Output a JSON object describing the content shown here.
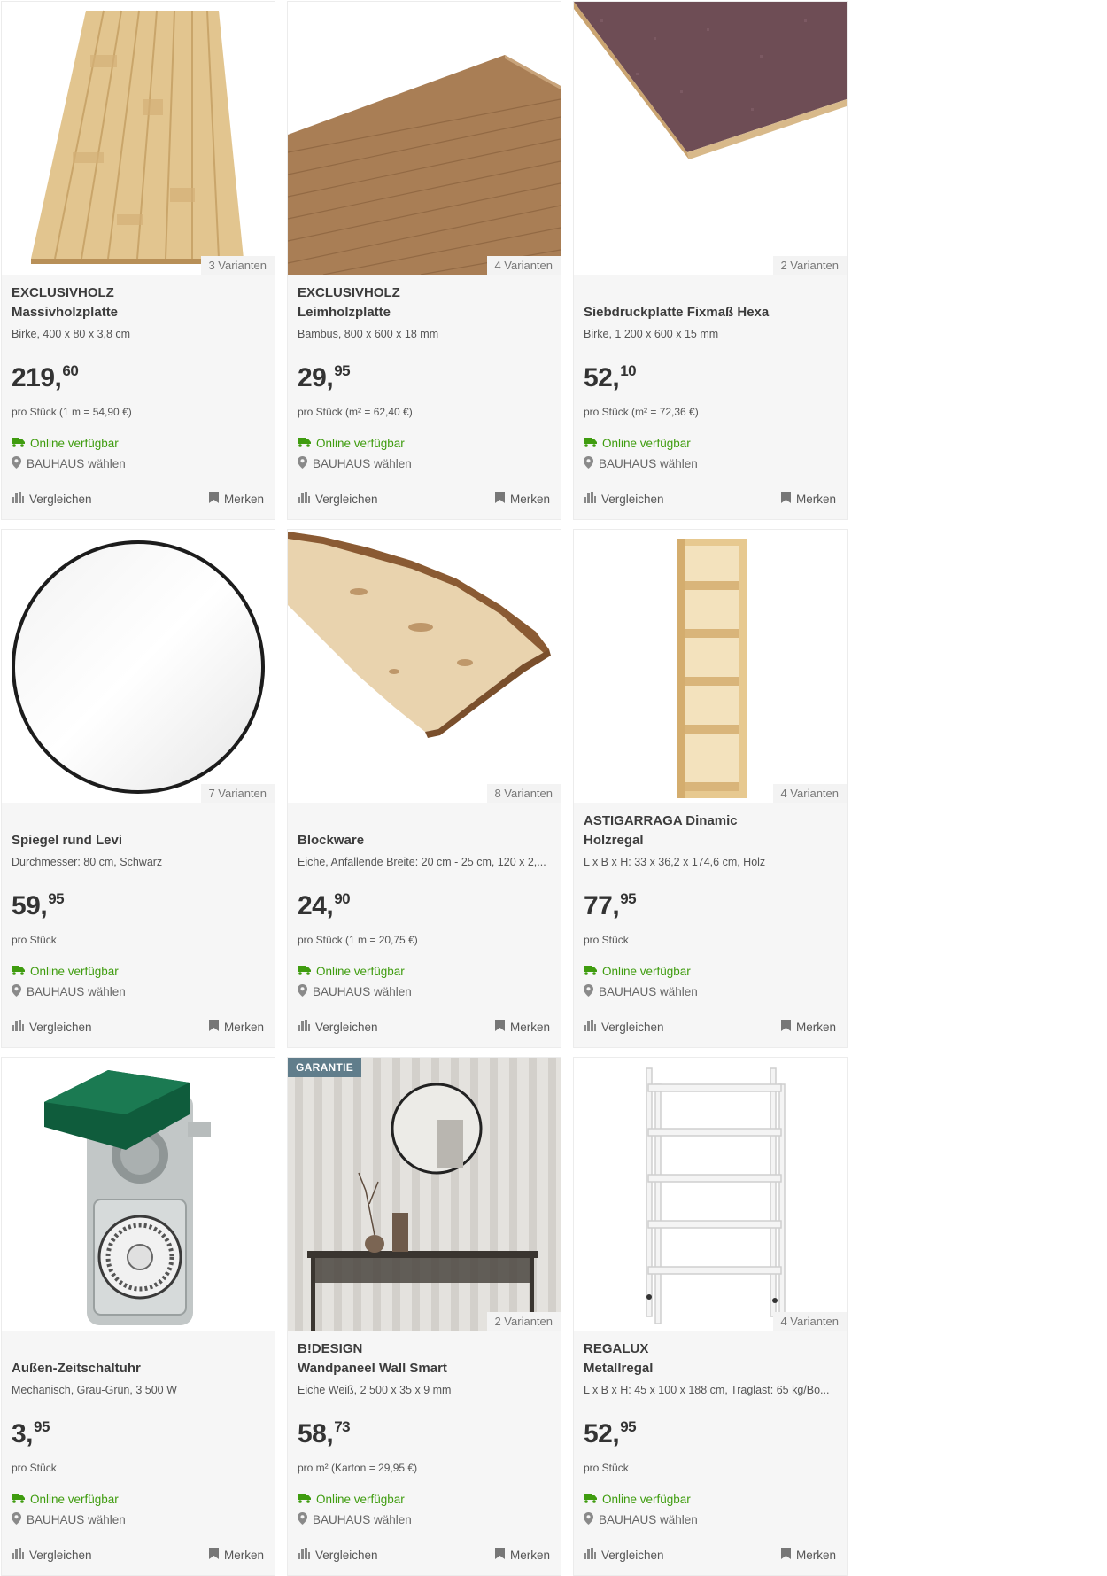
{
  "ui": {
    "online_label": "Online verfügbar",
    "store_label": "BAUHAUS wählen",
    "compare_label": "Vergleichen",
    "remember_label": "Merken"
  },
  "colors": {
    "online_green": "#3f9c0f",
    "badge": "#607d8b",
    "card_bg": "#f6f6f6"
  },
  "products": [
    {
      "brand": "EXCLUSIVHOLZ",
      "name": "Massivholzplatte",
      "spec": "Birke, 400 x 80 x 3,8 cm",
      "price_main": "219,",
      "price_cents": "60",
      "unit": "pro Stück (1 m = 54,90 €)",
      "variants": "3 Varianten",
      "badge": "",
      "image": "birch-board"
    },
    {
      "brand": "EXCLUSIVHOLZ",
      "name": "Leimholzplatte",
      "spec": "Bambus, 800 x 600 x 18 mm",
      "price_main": "29,",
      "price_cents": "95",
      "unit": "pro Stück (m² = 62,40 €)",
      "variants": "4 Varianten",
      "badge": "",
      "image": "bamboo-board"
    },
    {
      "brand": "",
      "name": "Siebdruckplatte Fixmaß Hexa",
      "spec": "Birke, 1 200 x 600 x 15 mm",
      "price_main": "52,",
      "price_cents": "10",
      "unit": "pro Stück (m² = 72,36 €)",
      "variants": "2 Varianten",
      "badge": "",
      "image": "screenprint-board"
    },
    {
      "brand": "",
      "name": "Spiegel rund Levi",
      "spec": "Durchmesser: 80 cm, Schwarz",
      "price_main": "59,",
      "price_cents": "95",
      "unit": "pro Stück",
      "variants": "7 Varianten",
      "badge": "",
      "image": "round-mirror"
    },
    {
      "brand": "",
      "name": "Blockware",
      "spec": "Eiche, Anfallende Breite: 20 cm - 25 cm, 120 x 2,...",
      "price_main": "24,",
      "price_cents": "90",
      "unit": "pro Stück (1 m = 20,75 €)",
      "variants": "8 Varianten",
      "badge": "",
      "image": "live-edge-board"
    },
    {
      "brand": "ASTIGARRAGA Dinamic",
      "name": "Holzregal",
      "spec": "L x B x H: 33 x 36,2 x 174,6 cm, Holz",
      "price_main": "77,",
      "price_cents": "95",
      "unit": "pro Stück",
      "variants": "4 Varianten",
      "badge": "",
      "image": "wood-shelf"
    },
    {
      "brand": "",
      "name": "Außen-Zeitschaltuhr",
      "spec": "Mechanisch, Grau-Grün, 3 500 W",
      "price_main": "3,",
      "price_cents": "95",
      "unit": "pro Stück",
      "variants": "",
      "badge": "",
      "image": "outdoor-timer"
    },
    {
      "brand": "B!DESIGN",
      "name": "Wandpaneel Wall Smart",
      "spec": "Eiche Weiß, 2 500 x 35 x 9 mm",
      "price_main": "58,",
      "price_cents": "73",
      "unit": "pro m² (Karton = 29,95 €)",
      "variants": "2 Varianten",
      "badge": "GARANTIE",
      "image": "wall-panel-scene"
    },
    {
      "brand": "REGALUX",
      "name": "Metallregal",
      "spec": "L x B x H: 45 x 100 x 188 cm, Traglast: 65 kg/Bo...",
      "price_main": "52,",
      "price_cents": "95",
      "unit": "pro Stück",
      "variants": "4 Varianten",
      "badge": "",
      "image": "metal-shelf"
    }
  ]
}
